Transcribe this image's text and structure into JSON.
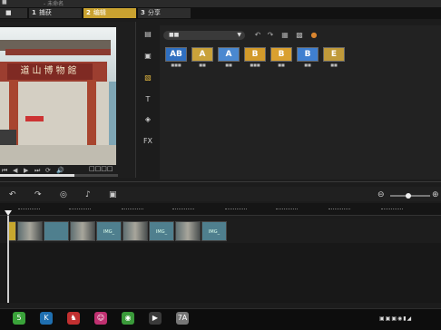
{
  "titlebar": {
    "app": "■",
    "subtitle": "- 未命名"
  },
  "steps": [
    {
      "num": "",
      "label": "■"
    },
    {
      "num": "1",
      "label": "捕获"
    },
    {
      "num": "2",
      "label": "编辑"
    },
    {
      "num": "3",
      "label": "分享"
    }
  ],
  "preview": {
    "sign_text": "道山博物館",
    "progress_fraction": 0.63,
    "timecode_label": "□□□□"
  },
  "controls": {
    "prev": "⏮",
    "rewind": "◀",
    "play": "▶",
    "next": "⏭",
    "repeat": "⟳",
    "volume": "🔊"
  },
  "sidetools": [
    {
      "name": "media-icon",
      "glyph": "▤"
    },
    {
      "name": "instant-project-icon",
      "glyph": "▣"
    },
    {
      "name": "transition-icon",
      "glyph": "▧"
    },
    {
      "name": "title-icon",
      "glyph": "T"
    },
    {
      "name": "graphic-icon",
      "glyph": "◈"
    },
    {
      "name": "filter-icon",
      "glyph": "FX"
    }
  ],
  "library": {
    "dropdown_value": "■■",
    "dropdown_arrow": "▼",
    "tools": [
      "↶",
      "↷",
      "▦",
      "▩",
      "●"
    ],
    "thumbs": [
      {
        "label": "AB",
        "caption": "■■■",
        "color": "#2f6fc0"
      },
      {
        "label": "A",
        "caption": "■■",
        "color": "#c9a23a"
      },
      {
        "label": "A",
        "caption": "■■",
        "color": "#4a88d0"
      },
      {
        "label": "B",
        "caption": "■■■",
        "color": "#d29a2a"
      },
      {
        "label": "B",
        "caption": "■■",
        "color": "#d9a030"
      },
      {
        "label": "B",
        "caption": "■■",
        "color": "#3f7fd0"
      },
      {
        "label": "E",
        "caption": "■■",
        "color": "#c09a3a"
      }
    ]
  },
  "timeline": {
    "tools": [
      "↶",
      "↷",
      "◎",
      "♪",
      "▣"
    ],
    "zoom_minus": "⊖",
    "zoom_plus": "⊕",
    "zoom_level": 0.45,
    "clips": [
      {
        "type": "sel",
        "label": ""
      },
      {
        "type": "photo",
        "label": ""
      },
      {
        "type": "trans",
        "label": ""
      },
      {
        "type": "photo",
        "label": ""
      },
      {
        "type": "trans",
        "label": "IMG_"
      },
      {
        "type": "photo",
        "label": ""
      },
      {
        "type": "trans",
        "label": "IMG_"
      },
      {
        "type": "photo",
        "label": ""
      },
      {
        "type": "trans",
        "label": "IMG_"
      }
    ]
  },
  "taskbar": {
    "apps": [
      {
        "glyph": "5",
        "color": "#3aa33a"
      },
      {
        "glyph": "K",
        "color": "#1f6fb0"
      },
      {
        "glyph": "♞",
        "color": "#c23030"
      },
      {
        "glyph": "☺",
        "color": "#c03070"
      },
      {
        "glyph": "◉",
        "color": "#3a9a3a"
      },
      {
        "glyph": "▶",
        "color": "#3a3a3a"
      },
      {
        "glyph": "7A",
        "color": "#777777"
      }
    ],
    "tray": "▣▣▣◉▮◢"
  }
}
